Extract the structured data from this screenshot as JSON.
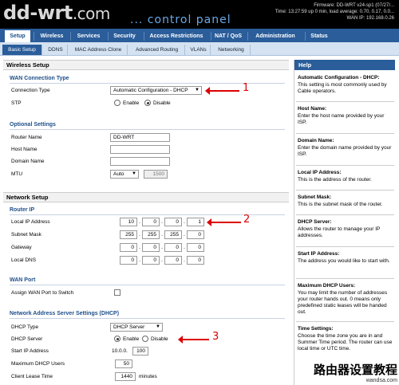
{
  "header": {
    "logo_main": "dd-wrt",
    "logo_tld": ".com",
    "subtitle": "... control panel",
    "firmware": "Firmware: DD-WRT v24-sp1 (07/27/...",
    "time": "Time: 13:27:59 up 0 min, load average: 0.70, 0.17, 0.0...",
    "wan_ip": "WAN IP: 192.168.0.26"
  },
  "main_tabs": [
    "Setup",
    "Wireless",
    "Services",
    "Security",
    "Access Restrictions",
    "NAT / QoS",
    "Administration",
    "Status"
  ],
  "sub_tabs": [
    "Basic Setup",
    "DDNS",
    "MAC Address Clone",
    "Advanced Routing",
    "VLANs",
    "Networking"
  ],
  "wireless_setup": {
    "section_title": "Wireless Setup",
    "wan_type_title": "WAN Connection Type",
    "connection_type_label": "Connection Type",
    "connection_type_value": "Automatic Configuration - DHCP",
    "stp_label": "STP",
    "stp_enable": "Enable",
    "stp_disable": "Disable",
    "optional_title": "Optional Settings",
    "router_name_label": "Router Name",
    "router_name_value": "DD-WRT",
    "host_name_label": "Host Name",
    "domain_name_label": "Domain Name",
    "mtu_label": "MTU",
    "mtu_mode": "Auto",
    "mtu_value": "1500"
  },
  "network_setup": {
    "section_title": "Network Setup",
    "router_ip_title": "Router IP",
    "local_ip_label": "Local IP Address",
    "local_ip": [
      "10",
      "0",
      "0",
      "1"
    ],
    "subnet_label": "Subnet Mask",
    "subnet": [
      "255",
      "255",
      "255",
      "0"
    ],
    "gateway_label": "Gateway",
    "gateway": [
      "0",
      "0",
      "0",
      "0"
    ],
    "local_dns_label": "Local DNS",
    "local_dns": [
      "0",
      "0",
      "0",
      "0"
    ],
    "wan_port_title": "WAN Port",
    "assign_wan_label": "Assign WAN Port to Switch",
    "dhcp_title": "Network Address Server Settings (DHCP)",
    "dhcp_type_label": "DHCP Type",
    "dhcp_type_value": "DHCP Server",
    "dhcp_server_label": "DHCP Server",
    "dhcp_enable": "Enable",
    "dhcp_disable": "Disable",
    "start_ip_label": "Start IP Address",
    "start_ip_prefix": "10.0.0.",
    "start_ip_last": "100",
    "max_users_label": "Maximum DHCP Users",
    "max_users_value": "50",
    "lease_label": "Client Lease Time",
    "lease_value": "1440",
    "lease_unit": "minutes"
  },
  "annotations": [
    "1",
    "2",
    "3"
  ],
  "help": {
    "title": "Help",
    "items": [
      {
        "t": "Automatic Configuration - DHCP:",
        "d": "This setting is most commonly used by Cable operators."
      },
      {
        "t": "Host Name:",
        "d": "Enter the host name provided by your ISP."
      },
      {
        "t": "Domain Name:",
        "d": "Enter the domain name provided by your ISP."
      },
      {
        "t": "Local IP Address:",
        "d": "This is the address of the router."
      },
      {
        "t": "Subnet Mask:",
        "d": "This is the subnet mask of the router."
      },
      {
        "t": "DHCP Server:",
        "d": "Allows the router to manage your IP addresses."
      },
      {
        "t": "Start IP Address:",
        "d": "The address you would like to start with."
      },
      {
        "t": "Maximum DHCP Users:",
        "d": "You may limit the number of addresses your router hands out. 0 means only predefined static leases will be handed out."
      },
      {
        "t": "Time Settings:",
        "d": "Choose the time zone you are in and Summer Time period. The router can use local time or UTC time."
      }
    ]
  },
  "watermark": {
    "big": "路由器设置教程",
    "small": "wandsa.com"
  },
  "colors": {
    "nav_blue": "#2a5d9a",
    "accent_red": "#dd0000",
    "header_black": "#000000"
  }
}
